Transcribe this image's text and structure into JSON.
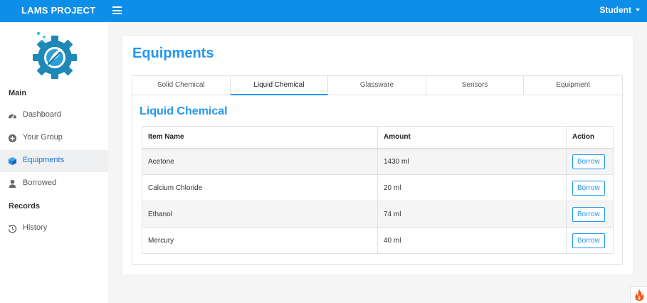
{
  "header": {
    "brand": "LAMS PROJECT",
    "user": "Student",
    "colors": {
      "bar": "#0d8ee8",
      "accent": "#2196f3"
    }
  },
  "sidebar": {
    "main_title": "Main",
    "records_title": "Records",
    "items": [
      {
        "label": "Dashboard",
        "icon": "tachometer-icon"
      },
      {
        "label": "Your Group",
        "icon": "plus-circle-icon"
      },
      {
        "label": "Equipments",
        "icon": "cube-icon",
        "active": true
      },
      {
        "label": "Borrowed",
        "icon": "user-icon"
      }
    ],
    "records_items": [
      {
        "label": "History",
        "icon": "history-icon"
      }
    ]
  },
  "main": {
    "title": "Equipments",
    "tabs": [
      {
        "label": "Solid Chemical"
      },
      {
        "label": "Liquid Chemical",
        "active": true
      },
      {
        "label": "Glassware"
      },
      {
        "label": "Sensors"
      },
      {
        "label": "Equipment"
      }
    ],
    "section_title": "Liquid Chemical",
    "table": {
      "headers": [
        "Item Name",
        "Amount",
        "Action"
      ],
      "rows": [
        {
          "name": "Acetone",
          "amount": "1430 ml",
          "action": "Borrow"
        },
        {
          "name": "Calcium Chloride",
          "amount": "20 ml",
          "action": "Borrow"
        },
        {
          "name": "Ethanol",
          "amount": "74 ml",
          "action": "Borrow"
        },
        {
          "name": "Mercury",
          "amount": "40 ml",
          "action": "Borrow"
        }
      ]
    }
  }
}
